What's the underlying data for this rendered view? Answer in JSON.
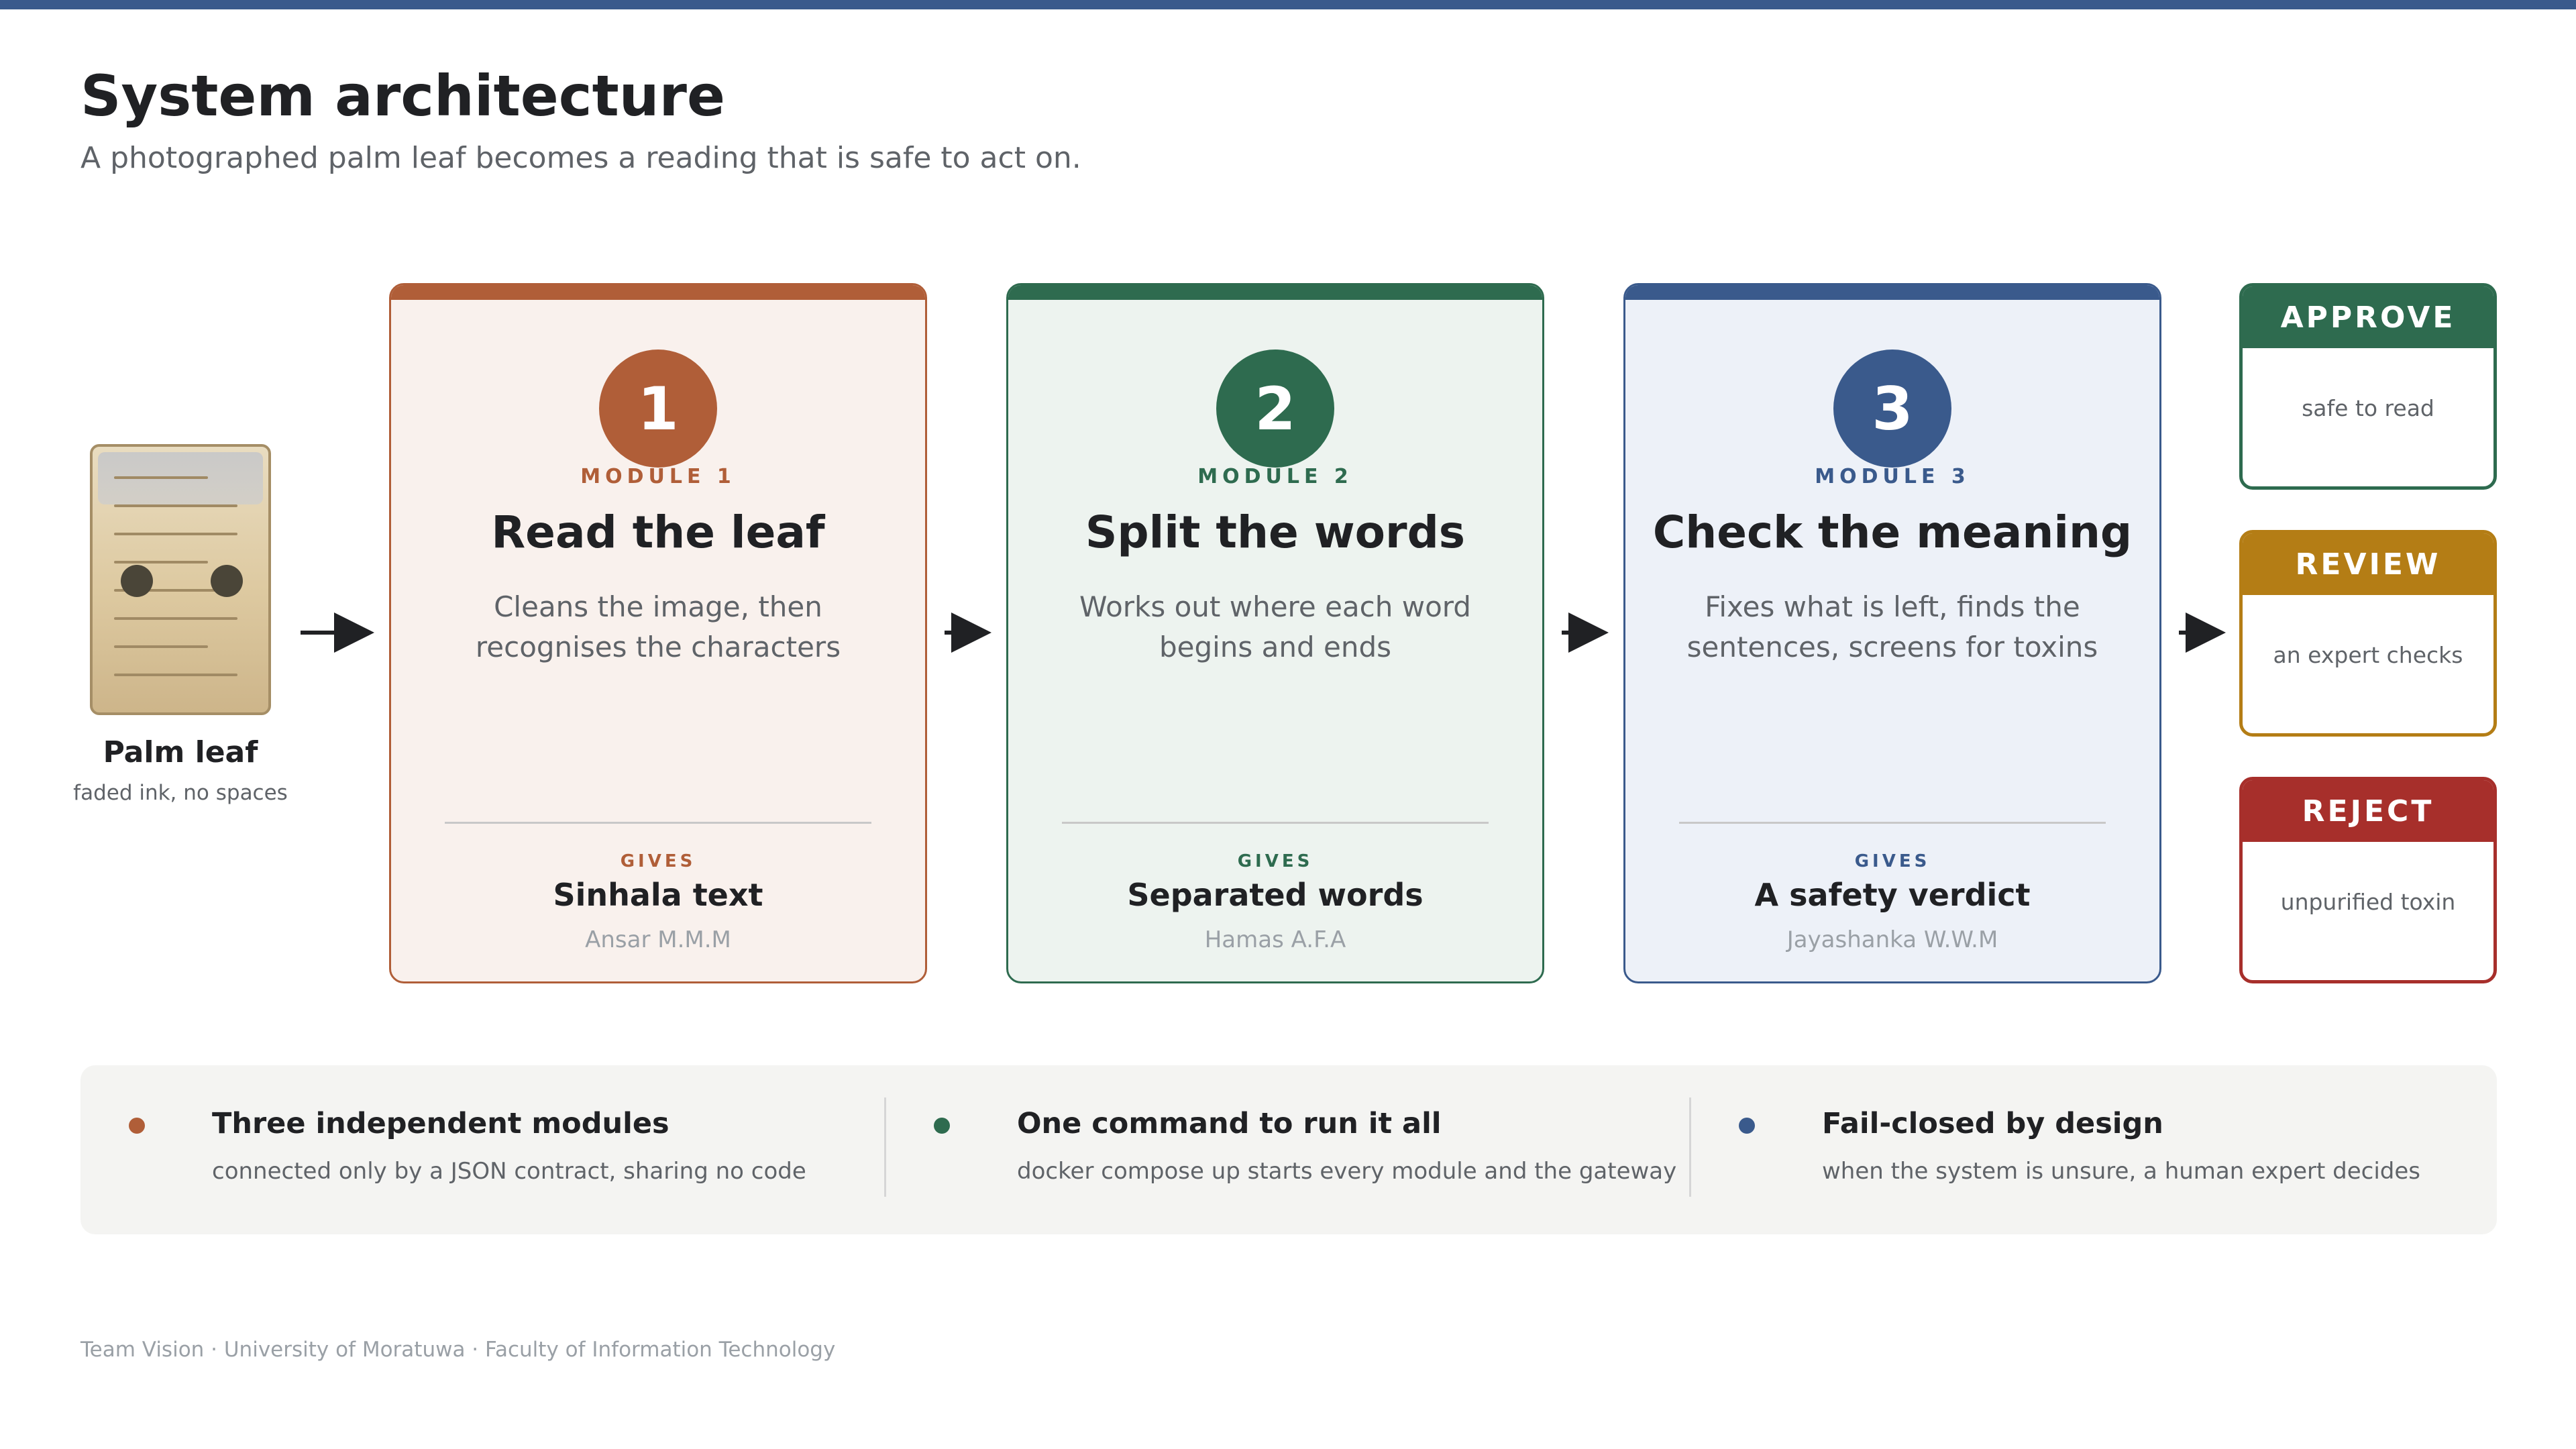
{
  "colors": {
    "accent_top": "#3a5a8c",
    "module1": "#b05e38",
    "module1_bg": "#f9f1ed",
    "module2": "#2e6b4f",
    "module2_bg": "#edf3ef",
    "module3": "#3a5a8c",
    "module3_bg": "#edf1f8",
    "approve": "#2e6b4f",
    "review": "#b47d15",
    "reject": "#a72f2b"
  },
  "header": {
    "title": "System architecture",
    "subtitle": "A photographed palm leaf becomes a reading that is safe to act on."
  },
  "input": {
    "title": "Palm leaf",
    "subtitle": "faded ink, no spaces",
    "icon": "palm-leaf-manuscript-icon"
  },
  "modules": [
    {
      "number": "1",
      "label": "MODULE 1",
      "name": "Read the leaf",
      "description": "Cleans the image, then recognises the characters",
      "gives_label": "GIVES",
      "gives": "Sinhala text",
      "author": "Ansar M.M.M"
    },
    {
      "number": "2",
      "label": "MODULE 2",
      "name": "Split the words",
      "description": "Works out where each word begins and ends",
      "gives_label": "GIVES",
      "gives": "Separated words",
      "author": "Hamas A.F.A"
    },
    {
      "number": "3",
      "label": "MODULE 3",
      "name": "Check the meaning",
      "description": "Fixes what is left, finds the sentences, screens for toxins",
      "gives_label": "GIVES",
      "gives": "A safety verdict",
      "author": "Jayashanka W.W.M"
    }
  ],
  "outcomes": [
    {
      "label": "APPROVE",
      "description": "safe to read"
    },
    {
      "label": "REVIEW",
      "description": "an expert checks"
    },
    {
      "label": "REJECT",
      "description": "unpurified toxin"
    }
  ],
  "notes": [
    {
      "title": "Three independent modules",
      "subtitle": "connected only by a JSON contract, sharing no code"
    },
    {
      "title": "One command to run it all",
      "subtitle": "docker compose up starts every module and the gateway"
    },
    {
      "title": "Fail-closed by design",
      "subtitle": "when the system is unsure, a human expert decides"
    }
  ],
  "footer": "Team Vision · University of Moratuwa · Faculty of Information Technology"
}
